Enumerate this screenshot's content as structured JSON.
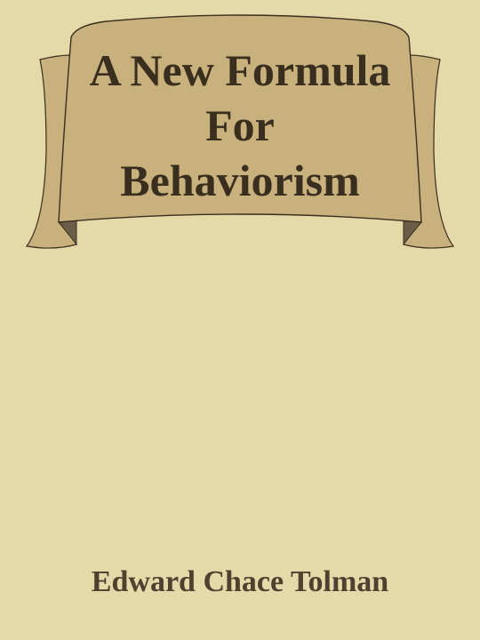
{
  "book": {
    "title_lines": [
      "A New Formula",
      "For",
      "Behaviorism"
    ],
    "author": "Edward Chace Tolman"
  },
  "colors": {
    "background": "#e6d9a9",
    "banner_fill": "#c8b17d",
    "banner_shadow": "#6b5d48",
    "text": "#3a2e1e"
  }
}
